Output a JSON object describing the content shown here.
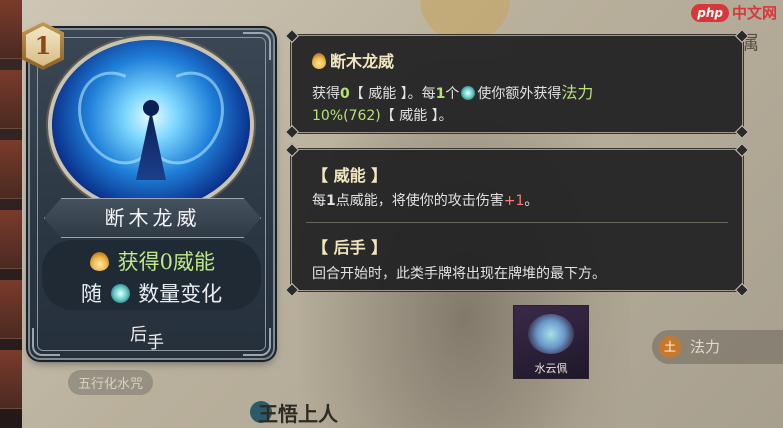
{
  "card": {
    "cost": "1",
    "title": "断木龙威",
    "desc_line1_text": "获得0威能",
    "desc_line2_pre": "随",
    "desc_line2_post": "数量变化",
    "tag_main": "后",
    "tag_sub": "手"
  },
  "tooltip": {
    "title": "断木龙威",
    "line1": {
      "t1": "获得",
      "v1": "0",
      "t2": "【 威能 】。每",
      "v2": "1",
      "t3": "个",
      "t4": "使你额外获得",
      "v3": "法力"
    },
    "line2": {
      "v1": "10%(762)",
      "t1": "【 威能 】。"
    }
  },
  "keywords": [
    {
      "heading": "【 威能 】",
      "pre": "每",
      "v1": "1",
      "mid": "点威能，将使你的攻击伤害",
      "v2": "+1",
      "post": "。"
    },
    {
      "heading": "【 后手 】",
      "text": "回合开始时，此类手牌将出现在牌堆的最下方。"
    }
  ],
  "background": {
    "right_label": "属",
    "tag_label": "五行化水咒",
    "hero_name": "王悟上人",
    "item_label": "水云佩",
    "chip_icon": "土",
    "chip_label": "法力"
  },
  "watermark": {
    "badge": "php",
    "text": "中文网"
  },
  "icons": {
    "flame": "flame-icon",
    "water": "water-drop-icon"
  },
  "colors": {
    "accent_green": "#b8e07a",
    "accent_red": "#ff7a6a",
    "panel_bg": "#202022",
    "heading": "#f1e6c0"
  }
}
